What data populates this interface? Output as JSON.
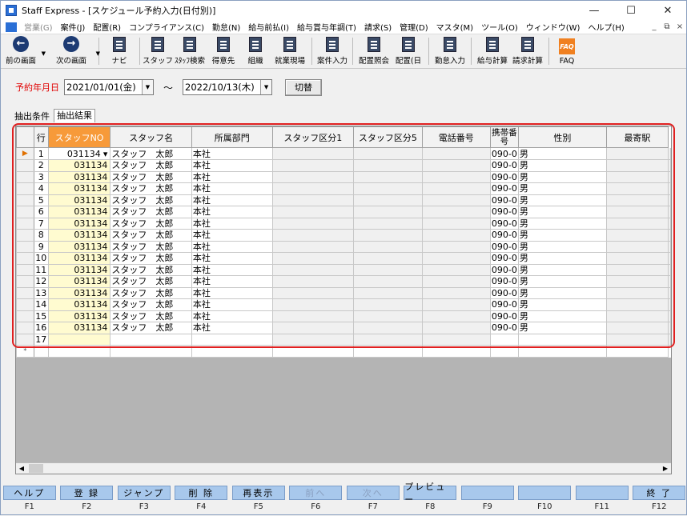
{
  "window": {
    "title": "Staff Express - [スケジュール予約入力(日付別)]"
  },
  "menu": [
    "営業(G)",
    "案件(J)",
    "配置(R)",
    "コンプライアンス(C)",
    "勤怠(N)",
    "給与前払(I)",
    "給与賞与年調(T)",
    "請求(S)",
    "管理(D)",
    "マスタ(M)",
    "ツール(O)",
    "ウィンドウ(W)",
    "ヘルプ(H)"
  ],
  "toolbar": [
    {
      "label": "前の画面",
      "icon": "arrow-left-icon"
    },
    {
      "label": "次の画面",
      "icon": "arrow-right-icon"
    },
    {
      "label": "ナビ",
      "icon": "navi-icon"
    },
    {
      "label": "スタッフ",
      "icon": "staff-icon"
    },
    {
      "label": "ｽﾀｯﾌ検索",
      "icon": "staff-search-icon"
    },
    {
      "label": "得意先",
      "icon": "client-icon"
    },
    {
      "label": "組織",
      "icon": "org-icon"
    },
    {
      "label": "就業現場",
      "icon": "worksite-icon"
    },
    {
      "label": "案件入力",
      "icon": "case-input-icon"
    },
    {
      "label": "配置照会",
      "icon": "placement-inquiry-icon"
    },
    {
      "label": "配置(日",
      "icon": "placement-day-icon"
    },
    {
      "label": "勤怠入力",
      "icon": "attendance-icon"
    },
    {
      "label": "給与計算",
      "icon": "payroll-icon"
    },
    {
      "label": "請求計算",
      "icon": "billing-icon"
    },
    {
      "label": "FAQ",
      "icon": "faq-icon"
    }
  ],
  "datebar": {
    "label": "予約年月日",
    "from": "2021/01/01(金)",
    "tilde": "～",
    "to": "2022/10/13(木)",
    "switch": "切替"
  },
  "tabs": {
    "condition": "抽出条件",
    "result": "抽出結果"
  },
  "grid": {
    "columns": [
      "行",
      "スタッフNO",
      "スタッフ名",
      "所属部門",
      "スタッフ区分1",
      "スタッフ区分5",
      "電話番号",
      "携帯番号",
      "性別",
      "最寄駅"
    ],
    "rows": [
      [
        "1",
        "031134",
        "スタッフ　太郎",
        "本社",
        "",
        "",
        "",
        "090-0",
        "男",
        ""
      ],
      [
        "2",
        "031134",
        "スタッフ　太郎",
        "本社",
        "",
        "",
        "",
        "090-0",
        "男",
        ""
      ],
      [
        "3",
        "031134",
        "スタッフ　太郎",
        "本社",
        "",
        "",
        "",
        "090-0",
        "男",
        ""
      ],
      [
        "4",
        "031134",
        "スタッフ　太郎",
        "本社",
        "",
        "",
        "",
        "090-0",
        "男",
        ""
      ],
      [
        "5",
        "031134",
        "スタッフ　太郎",
        "本社",
        "",
        "",
        "",
        "090-0",
        "男",
        ""
      ],
      [
        "6",
        "031134",
        "スタッフ　太郎",
        "本社",
        "",
        "",
        "",
        "090-0",
        "男",
        ""
      ],
      [
        "7",
        "031134",
        "スタッフ　太郎",
        "本社",
        "",
        "",
        "",
        "090-0",
        "男",
        ""
      ],
      [
        "8",
        "031134",
        "スタッフ　太郎",
        "本社",
        "",
        "",
        "",
        "090-0",
        "男",
        ""
      ],
      [
        "9",
        "031134",
        "スタッフ　太郎",
        "本社",
        "",
        "",
        "",
        "090-0",
        "男",
        ""
      ],
      [
        "10",
        "031134",
        "スタッフ　太郎",
        "本社",
        "",
        "",
        "",
        "090-0",
        "男",
        ""
      ],
      [
        "11",
        "031134",
        "スタッフ　太郎",
        "本社",
        "",
        "",
        "",
        "090-0",
        "男",
        ""
      ],
      [
        "12",
        "031134",
        "スタッフ　太郎",
        "本社",
        "",
        "",
        "",
        "090-0",
        "男",
        ""
      ],
      [
        "13",
        "031134",
        "スタッフ　太郎",
        "本社",
        "",
        "",
        "",
        "090-0",
        "男",
        ""
      ],
      [
        "14",
        "031134",
        "スタッフ　太郎",
        "本社",
        "",
        "",
        "",
        "090-0",
        "男",
        ""
      ],
      [
        "15",
        "031134",
        "スタッフ　太郎",
        "本社",
        "",
        "",
        "",
        "090-0",
        "男",
        ""
      ],
      [
        "16",
        "031134",
        "スタッフ　太郎",
        "本社",
        "",
        "",
        "",
        "090-0",
        "男",
        ""
      ],
      [
        "17",
        "",
        "",
        "",
        "",
        "",
        "",
        "",
        "",
        ""
      ]
    ],
    "new_row_marker": "*"
  },
  "fkeys": [
    {
      "label": "ヘルプ",
      "key": "F1",
      "enabled": true
    },
    {
      "label": "登 録",
      "key": "F2",
      "enabled": true
    },
    {
      "label": "ジャンプ",
      "key": "F3",
      "enabled": true
    },
    {
      "label": "削 除",
      "key": "F4",
      "enabled": true
    },
    {
      "label": "再表示",
      "key": "F5",
      "enabled": true
    },
    {
      "label": "前へ",
      "key": "F6",
      "enabled": false
    },
    {
      "label": "次へ",
      "key": "F7",
      "enabled": false
    },
    {
      "label": "プレビュー",
      "key": "F8",
      "enabled": true
    },
    {
      "label": "",
      "key": "F9",
      "enabled": true
    },
    {
      "label": "",
      "key": "F10",
      "enabled": true
    },
    {
      "label": "",
      "key": "F11",
      "enabled": true
    },
    {
      "label": "終 了",
      "key": "F12",
      "enabled": true
    }
  ]
}
